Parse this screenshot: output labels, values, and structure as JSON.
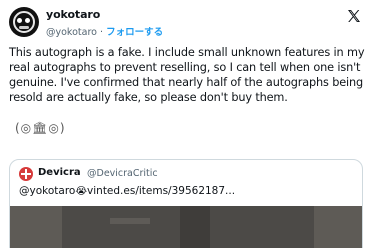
{
  "author": {
    "name": "yokotaro",
    "handle": "@yokotaro",
    "separator": "·",
    "follow_label": "フォローする",
    "verified_color": "#1d9bf0"
  },
  "tweet": {
    "text": "This autograph is a fake. I include small unknown features in my real autographs to prevent reselling, so I can tell when one isn't genuine. I've confirmed that nearly half of the autographs being resold are actually fake, so please don't buy them.",
    "emoji": "(◎🏛◎)"
  },
  "quote": {
    "name": "Devicra",
    "handle": "@DevicraCritic",
    "mention": "@yokotaro",
    "emoji": "😭",
    "link": "vinted.es/items/39562187..."
  },
  "icons": {
    "logo": "x-logo-icon",
    "avatar": "avatar-face-icon"
  }
}
